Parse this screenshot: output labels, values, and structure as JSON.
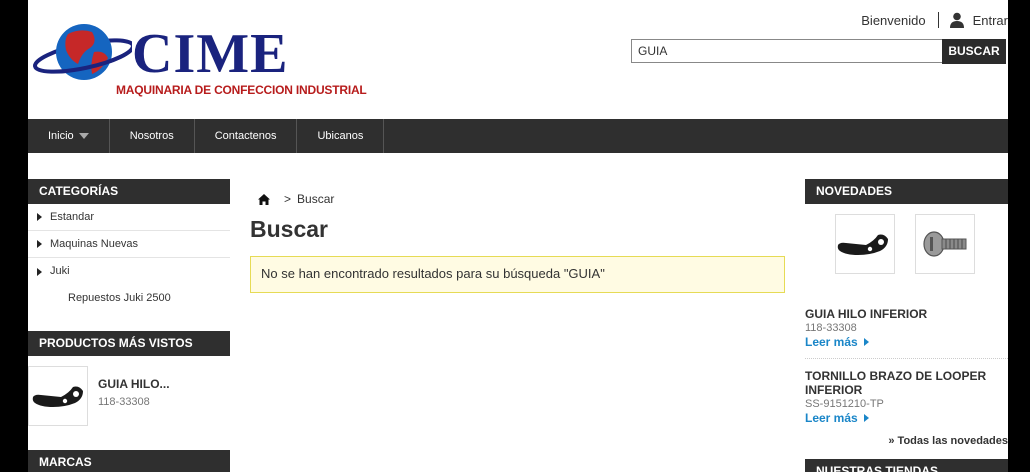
{
  "header": {
    "logo_text": "CIME",
    "logo_subtitle": "MAQUINARIA DE CONFECCION INDUSTRIAL",
    "welcome": "Bienvenido",
    "login": "Entrar",
    "search_value": "GUIA",
    "search_button": "BUSCAR"
  },
  "nav": {
    "items": [
      "Inicio",
      "Nosotros",
      "Contactenos",
      "Ubicanos"
    ]
  },
  "categories": {
    "title": "CATEGORÍAS",
    "items": [
      "Estandar",
      "Maquinas Nuevas",
      "Juki"
    ],
    "sub_item": "Repuestos Juki 2500"
  },
  "most_viewed": {
    "title": "PRODUCTOS MÁS VISTOS",
    "item_name": "GUIA HILO...",
    "item_ref": "118-33308"
  },
  "brands": {
    "title": "MARCAS"
  },
  "main": {
    "breadcrumb_current": "Buscar",
    "breadcrumb_sep": ">",
    "heading": "Buscar",
    "alert": "No se han encontrado resultados para su búsqueda \"GUIA\""
  },
  "news": {
    "title": "NOVEDADES",
    "items": [
      {
        "name": "GUIA HILO INFERIOR",
        "ref": "118-33308",
        "more": "Leer más"
      },
      {
        "name": "TORNILLO BRAZO DE LOOPER INFERIOR",
        "ref": "SS-9151210-TP",
        "more": "Leer más"
      }
    ],
    "all_link": "» Todas las novedades"
  },
  "stores": {
    "title": "NUESTRAS TIENDAS"
  },
  "colors": {
    "nav_bg": "#2f2f2f",
    "link_blue": "#1a86c8",
    "logo_navy": "#1a237e",
    "logo_red": "#b71c1c",
    "alert_bg": "#fffbe3",
    "alert_border": "#e6db55"
  }
}
